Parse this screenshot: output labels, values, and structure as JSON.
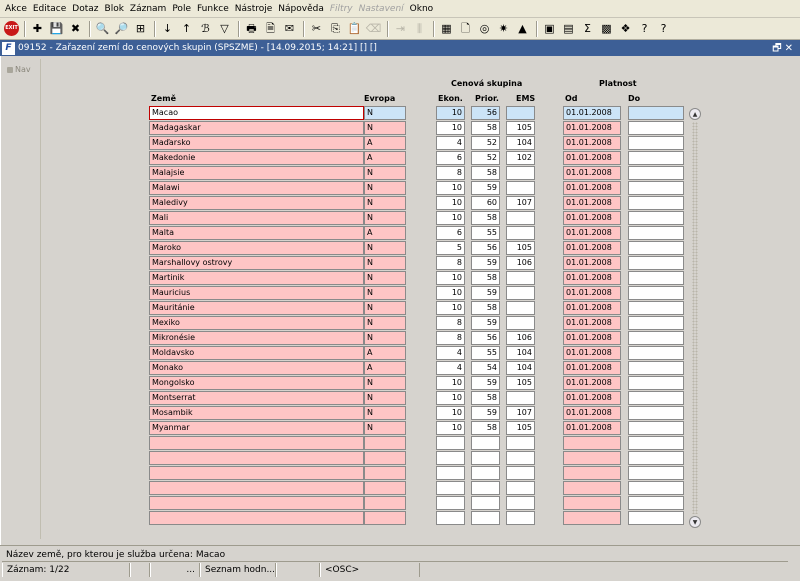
{
  "menu": [
    "Akce",
    "Editace",
    "Dotaz",
    "Blok",
    "Záznam",
    "Pole",
    "Funkce",
    "Nástroje",
    "Nápověda",
    "Filtry",
    "Nastavení",
    "Okno"
  ],
  "menu_disabled": [
    "Filtry",
    "Nastavení"
  ],
  "toolbar": {
    "exit_label": "EXIT",
    "icons": [
      {
        "name": "exit-icon",
        "glyph": "EXIT"
      },
      {
        "name": "sep"
      },
      {
        "name": "new-record-icon",
        "glyph": "✚"
      },
      {
        "name": "save-icon",
        "glyph": "💾"
      },
      {
        "name": "delete-record-icon",
        "glyph": "✖"
      },
      {
        "name": "sep"
      },
      {
        "name": "query-enter-icon",
        "glyph": "🔍"
      },
      {
        "name": "query-execute-icon",
        "glyph": "🔎"
      },
      {
        "name": "query-count-icon",
        "glyph": "⊞"
      },
      {
        "name": "sep"
      },
      {
        "name": "sort-asc-icon",
        "glyph": "↓"
      },
      {
        "name": "sort-desc-icon",
        "glyph": "↑"
      },
      {
        "name": "lov-icon",
        "glyph": "ℬ"
      },
      {
        "name": "filter-icon",
        "glyph": "▽"
      },
      {
        "name": "sep"
      },
      {
        "name": "print-icon",
        "glyph": "🖶"
      },
      {
        "name": "preview-icon",
        "glyph": "🗎"
      },
      {
        "name": "email-icon",
        "glyph": "✉"
      },
      {
        "name": "sep"
      },
      {
        "name": "cut-icon",
        "glyph": "✂"
      },
      {
        "name": "copy-icon",
        "glyph": "⎘"
      },
      {
        "name": "paste-icon",
        "glyph": "📋"
      },
      {
        "name": "clear-icon",
        "glyph": "⌫",
        "dim": true
      },
      {
        "name": "sep"
      },
      {
        "name": "insert-icon",
        "glyph": "⇥",
        "dim": true
      },
      {
        "name": "split-icon",
        "glyph": "⫼",
        "dim": true
      },
      {
        "name": "sep"
      },
      {
        "name": "calculator-icon",
        "glyph": "▦"
      },
      {
        "name": "document-icon",
        "glyph": "🗋"
      },
      {
        "name": "globe-icon",
        "glyph": "◎"
      },
      {
        "name": "settings-icon",
        "glyph": "✷"
      },
      {
        "name": "warning-icon",
        "glyph": "▲"
      },
      {
        "name": "sep"
      },
      {
        "name": "chart-icon",
        "glyph": "▣"
      },
      {
        "name": "calendar-icon",
        "glyph": "▤"
      },
      {
        "name": "sum-icon",
        "glyph": "Σ"
      },
      {
        "name": "excel-icon",
        "glyph": "▩"
      },
      {
        "name": "web-icon",
        "glyph": "❖"
      },
      {
        "name": "help-icon",
        "glyph": "?"
      },
      {
        "name": "context-help-icon",
        "glyph": "?"
      }
    ]
  },
  "window": {
    "logo": "F",
    "title": "09152 - Zařazení zemí do cenových skupin (SPSZME) - [14.09.2015; 14:21] [] []",
    "controls": "🗗✕"
  },
  "nav": {
    "label": "Nav"
  },
  "headers": {
    "zeme": "Země",
    "evropa": "Evropa",
    "cenova_skupina": "Cenová skupina",
    "ekon": "Ekon.",
    "prior": "Prior.",
    "ems": "EMS",
    "platnost": "Platnost",
    "od": "Od",
    "do": "Do"
  },
  "rows": [
    {
      "zeme": "Macao",
      "evropa": "N",
      "ekon": "10",
      "prior": "56",
      "ems": "",
      "od": "01.01.2008",
      "do": ""
    },
    {
      "zeme": "Madagaskar",
      "evropa": "N",
      "ekon": "10",
      "prior": "58",
      "ems": "105",
      "od": "01.01.2008",
      "do": ""
    },
    {
      "zeme": "Maďarsko",
      "evropa": "A",
      "ekon": "4",
      "prior": "52",
      "ems": "104",
      "od": "01.01.2008",
      "do": ""
    },
    {
      "zeme": "Makedonie",
      "evropa": "A",
      "ekon": "6",
      "prior": "52",
      "ems": "102",
      "od": "01.01.2008",
      "do": ""
    },
    {
      "zeme": "Malajsie",
      "evropa": "N",
      "ekon": "8",
      "prior": "58",
      "ems": "",
      "od": "01.01.2008",
      "do": ""
    },
    {
      "zeme": "Malawi",
      "evropa": "N",
      "ekon": "10",
      "prior": "59",
      "ems": "",
      "od": "01.01.2008",
      "do": ""
    },
    {
      "zeme": "Maledivy",
      "evropa": "N",
      "ekon": "10",
      "prior": "60",
      "ems": "107",
      "od": "01.01.2008",
      "do": ""
    },
    {
      "zeme": "Mali",
      "evropa": "N",
      "ekon": "10",
      "prior": "58",
      "ems": "",
      "od": "01.01.2008",
      "do": ""
    },
    {
      "zeme": "Malta",
      "evropa": "A",
      "ekon": "6",
      "prior": "55",
      "ems": "",
      "od": "01.01.2008",
      "do": ""
    },
    {
      "zeme": "Maroko",
      "evropa": "N",
      "ekon": "5",
      "prior": "56",
      "ems": "105",
      "od": "01.01.2008",
      "do": ""
    },
    {
      "zeme": "Marshallovy ostrovy",
      "evropa": "N",
      "ekon": "8",
      "prior": "59",
      "ems": "106",
      "od": "01.01.2008",
      "do": ""
    },
    {
      "zeme": "Martinik",
      "evropa": "N",
      "ekon": "10",
      "prior": "58",
      "ems": "",
      "od": "01.01.2008",
      "do": ""
    },
    {
      "zeme": "Mauricius",
      "evropa": "N",
      "ekon": "10",
      "prior": "59",
      "ems": "",
      "od": "01.01.2008",
      "do": ""
    },
    {
      "zeme": "Mauritánie",
      "evropa": "N",
      "ekon": "10",
      "prior": "58",
      "ems": "",
      "od": "01.01.2008",
      "do": ""
    },
    {
      "zeme": "Mexiko",
      "evropa": "N",
      "ekon": "8",
      "prior": "59",
      "ems": "",
      "od": "01.01.2008",
      "do": ""
    },
    {
      "zeme": "Mikronésie",
      "evropa": "N",
      "ekon": "8",
      "prior": "56",
      "ems": "106",
      "od": "01.01.2008",
      "do": ""
    },
    {
      "zeme": "Moldavsko",
      "evropa": "A",
      "ekon": "4",
      "prior": "55",
      "ems": "104",
      "od": "01.01.2008",
      "do": ""
    },
    {
      "zeme": "Monako",
      "evropa": "A",
      "ekon": "4",
      "prior": "54",
      "ems": "104",
      "od": "01.01.2008",
      "do": ""
    },
    {
      "zeme": "Mongolsko",
      "evropa": "N",
      "ekon": "10",
      "prior": "59",
      "ems": "105",
      "od": "01.01.2008",
      "do": ""
    },
    {
      "zeme": "Montserrat",
      "evropa": "N",
      "ekon": "10",
      "prior": "58",
      "ems": "",
      "od": "01.01.2008",
      "do": ""
    },
    {
      "zeme": "Mosambik",
      "evropa": "N",
      "ekon": "10",
      "prior": "59",
      "ems": "107",
      "od": "01.01.2008",
      "do": ""
    },
    {
      "zeme": "Myanmar",
      "evropa": "N",
      "ekon": "10",
      "prior": "58",
      "ems": "105",
      "od": "01.01.2008",
      "do": ""
    },
    {
      "zeme": "",
      "evropa": "",
      "ekon": "",
      "prior": "",
      "ems": "",
      "od": "",
      "do": ""
    },
    {
      "zeme": "",
      "evropa": "",
      "ekon": "",
      "prior": "",
      "ems": "",
      "od": "",
      "do": ""
    },
    {
      "zeme": "",
      "evropa": "",
      "ekon": "",
      "prior": "",
      "ems": "",
      "od": "",
      "do": ""
    },
    {
      "zeme": "",
      "evropa": "",
      "ekon": "",
      "prior": "",
      "ems": "",
      "od": "",
      "do": ""
    },
    {
      "zeme": "",
      "evropa": "",
      "ekon": "",
      "prior": "",
      "ems": "",
      "od": "",
      "do": ""
    },
    {
      "zeme": "",
      "evropa": "",
      "ekon": "",
      "prior": "",
      "ems": "",
      "od": "",
      "do": ""
    }
  ],
  "scrollbar": {
    "up": "▲",
    "down": "▼"
  },
  "status": {
    "message": "Název země, pro kterou je služba určena: Macao",
    "record": "Záznam: 1/22",
    "blank1": "",
    "dots": "...",
    "list": "Seznam hodn...",
    "blank2": "",
    "osc": "<OSC>"
  },
  "colors": {
    "required_field": "#fec5c5",
    "current_field": "#cce4f7",
    "title_bar": "#3d5f96"
  }
}
